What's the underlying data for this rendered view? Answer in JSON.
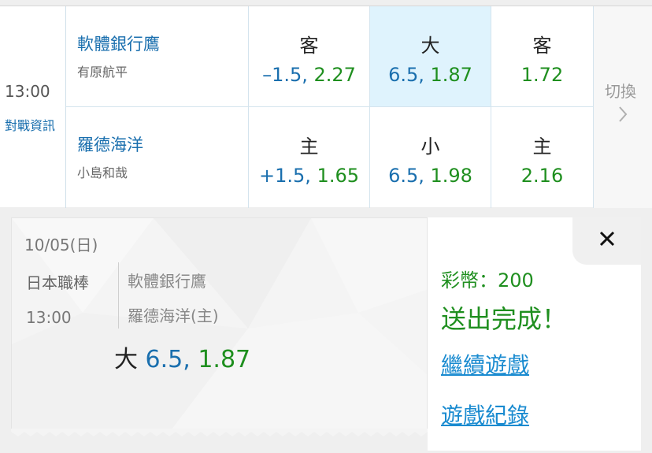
{
  "game": {
    "time": "13:00",
    "matchup_link": "對戰資訊",
    "away": {
      "team": "軟體銀行鷹",
      "pitcher": "有原航平"
    },
    "home": {
      "team": "羅德海洋",
      "pitcher": "小島和哉"
    },
    "odds": {
      "row1": [
        {
          "label": "客",
          "line": "–1.5,",
          "price": "2.27",
          "selected": false
        },
        {
          "label": "大",
          "line": "6.5,",
          "price": "1.87",
          "selected": true
        },
        {
          "label": "客",
          "line": "",
          "price": "1.72",
          "selected": false
        }
      ],
      "row2": [
        {
          "label": "主",
          "line": "+1.5,",
          "price": "1.65",
          "selected": false
        },
        {
          "label": "小",
          "line": "6.5,",
          "price": "1.98",
          "selected": false
        },
        {
          "label": "主",
          "line": "",
          "price": "2.16",
          "selected": false
        }
      ]
    },
    "switch_label": "切換"
  },
  "ticket": {
    "date": "10/05(日)",
    "league": "日本職棒",
    "time": "13:00",
    "away_team": "軟體銀行鷹",
    "home_team": "羅德海洋(主)",
    "pick_label": "大",
    "pick_line": "6.5,",
    "pick_price": "1.87"
  },
  "result": {
    "coins_text": "彩幣：200",
    "status": "送出完成！",
    "continue_link": "繼續遊戲",
    "history_link": "遊戲紀錄"
  },
  "colors": {
    "blue": "#1a6fae",
    "green": "#1f8f1f",
    "link": "#1a8bd0",
    "selected_bg": "#dff3fd"
  },
  "icons": {
    "switch": "chevron-right-icon",
    "close": "close-icon"
  }
}
